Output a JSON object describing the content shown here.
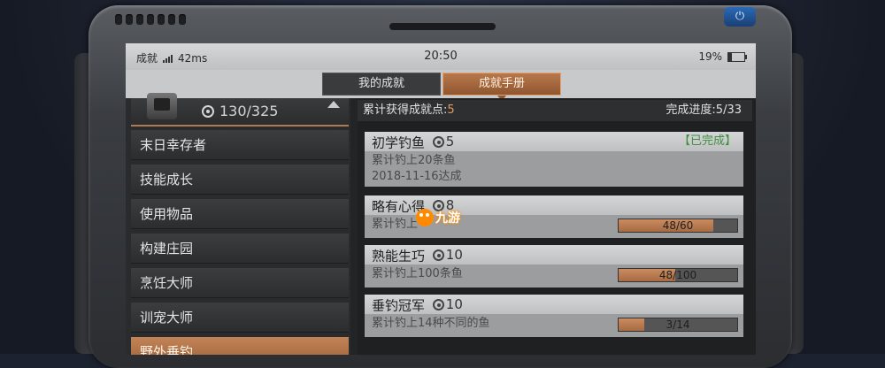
{
  "status": {
    "app": "成就",
    "signal": "42ms",
    "time": "20:50",
    "battery": "19%"
  },
  "tabs": [
    {
      "label": "我的成就"
    },
    {
      "label": "成就手册"
    }
  ],
  "profile": {
    "points": "130/325"
  },
  "categories": [
    {
      "label": "末日幸存者"
    },
    {
      "label": "技能成长"
    },
    {
      "label": "使用物品"
    },
    {
      "label": "构建庄园"
    },
    {
      "label": "烹饪大师"
    },
    {
      "label": "训宠大师"
    },
    {
      "label": "野外垂钓"
    }
  ],
  "summary": {
    "label": "累计获得成就点:",
    "points": "5",
    "progress": "完成进度:5/33"
  },
  "achievements": [
    {
      "name": "初学钓鱼",
      "reward": "5",
      "desc": "累计钓上20条鱼",
      "date": "2018-11-16达成",
      "status": "【已完成】"
    },
    {
      "name": "略有心得",
      "reward": "8",
      "desc": "累计钓上",
      "progress_text": "48/60",
      "progress_value": 0.8
    },
    {
      "name": "熟能生巧",
      "reward": "10",
      "desc": "累计钓上100条鱼",
      "progress_text": "48/100",
      "progress_value": 0.48
    },
    {
      "name": "垂钓冠军",
      "reward": "10",
      "desc": "累计钓上14种不同的鱼",
      "progress_text": "3/14",
      "progress_value": 0.214
    }
  ],
  "watermark": "九游",
  "colors": {
    "accent": "#b9784c",
    "complete": "#3f8f3f",
    "progress_fill": "#c98b5f"
  }
}
